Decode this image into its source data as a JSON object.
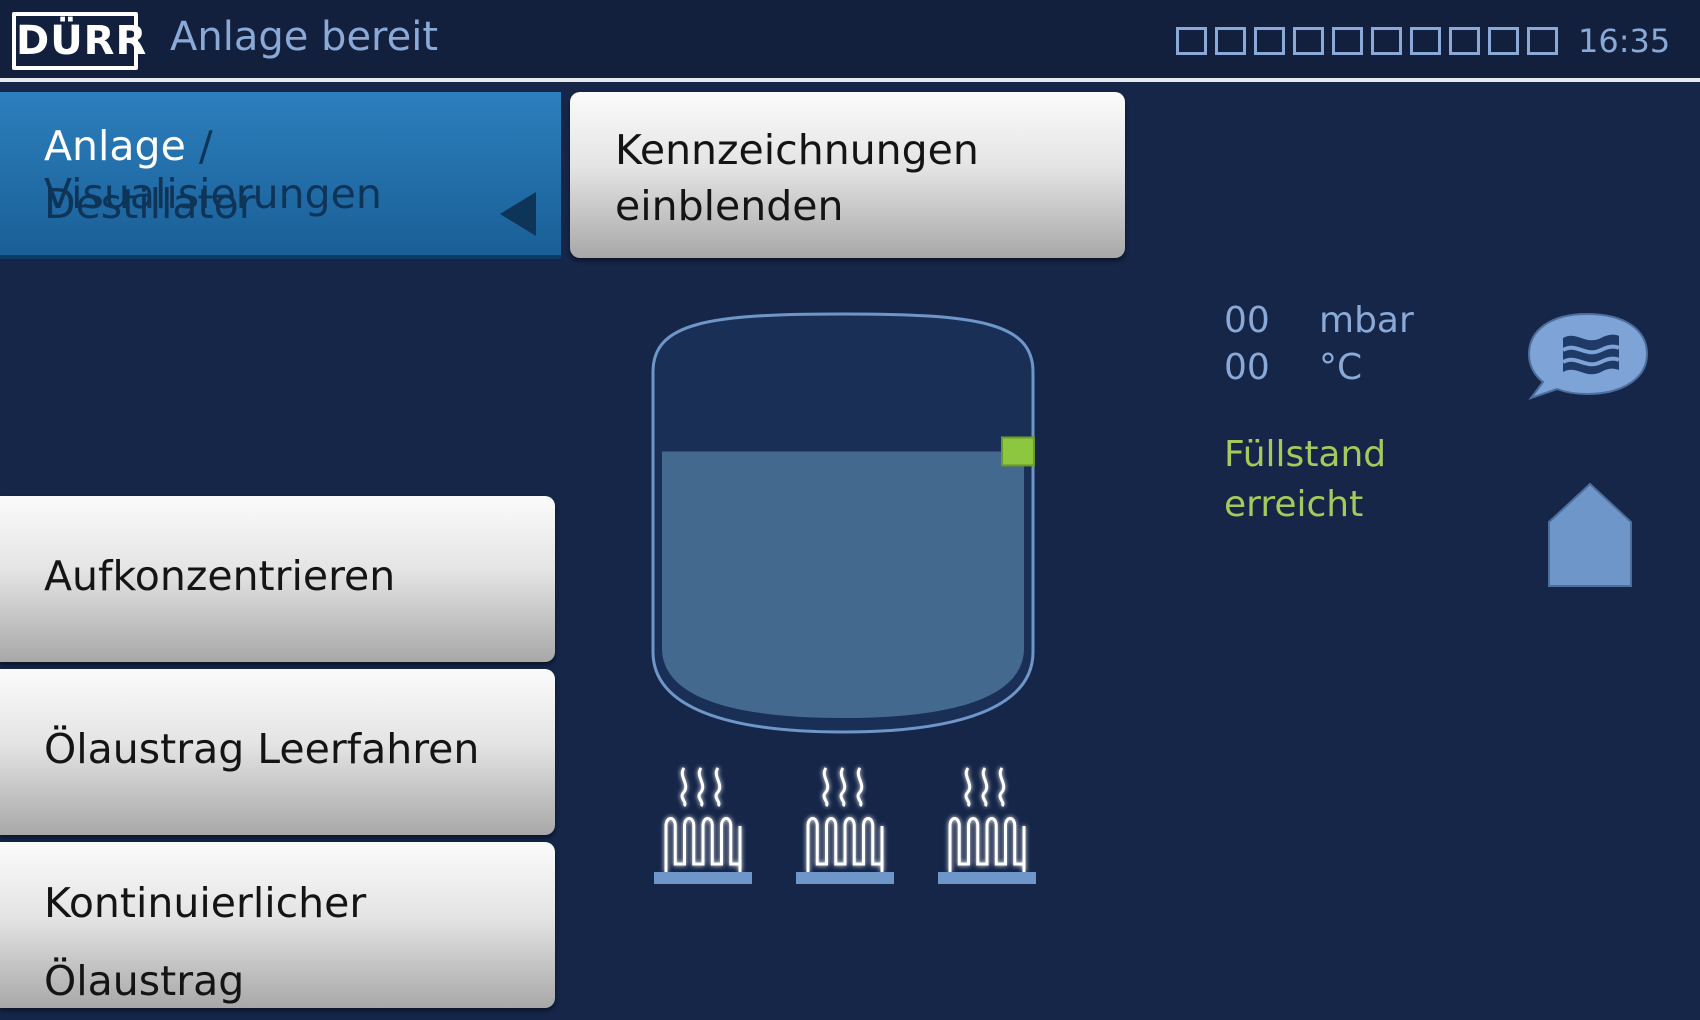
{
  "header": {
    "logo_text": "DÜRR",
    "status": "Anlage bereit",
    "progress_segments_total": 10,
    "progress_segments_filled": 0,
    "time": "16:35"
  },
  "breadcrumb": {
    "root": "Anlage",
    "separator": "/",
    "section": "Visualisierungen",
    "page": "Destillator",
    "back_icon": "triangle-left-icon"
  },
  "buttons": {
    "kennzeichnungen": [
      "Kennzeichnungen",
      "einblenden"
    ],
    "aufkonzentrieren": "Aufkonzentrieren",
    "oelaustrag_leerfahren": "Ölaustrag Leerfahren",
    "kontinuierlicher": [
      "Kontinuierlicher",
      "Ölaustrag"
    ]
  },
  "tank": {
    "fill_level_fraction": 0.68,
    "level_sensor_color": "#8dc63f",
    "liquid_color": "#44698f",
    "heater_count": 3
  },
  "readouts": {
    "pressure_value": "00",
    "pressure_unit": "mbar",
    "temperature_value": "00",
    "temperature_unit": "°C"
  },
  "fill_status": [
    "Füllstand",
    "erreicht"
  ],
  "icons": {
    "chat": "chat-bubble-icon",
    "home": "home-icon"
  },
  "colors": {
    "background": "#152649",
    "accent_blue": "#8aa9d6",
    "status_green": "#a5c95a",
    "breadcrumb_blue": "#2c7fbd"
  }
}
